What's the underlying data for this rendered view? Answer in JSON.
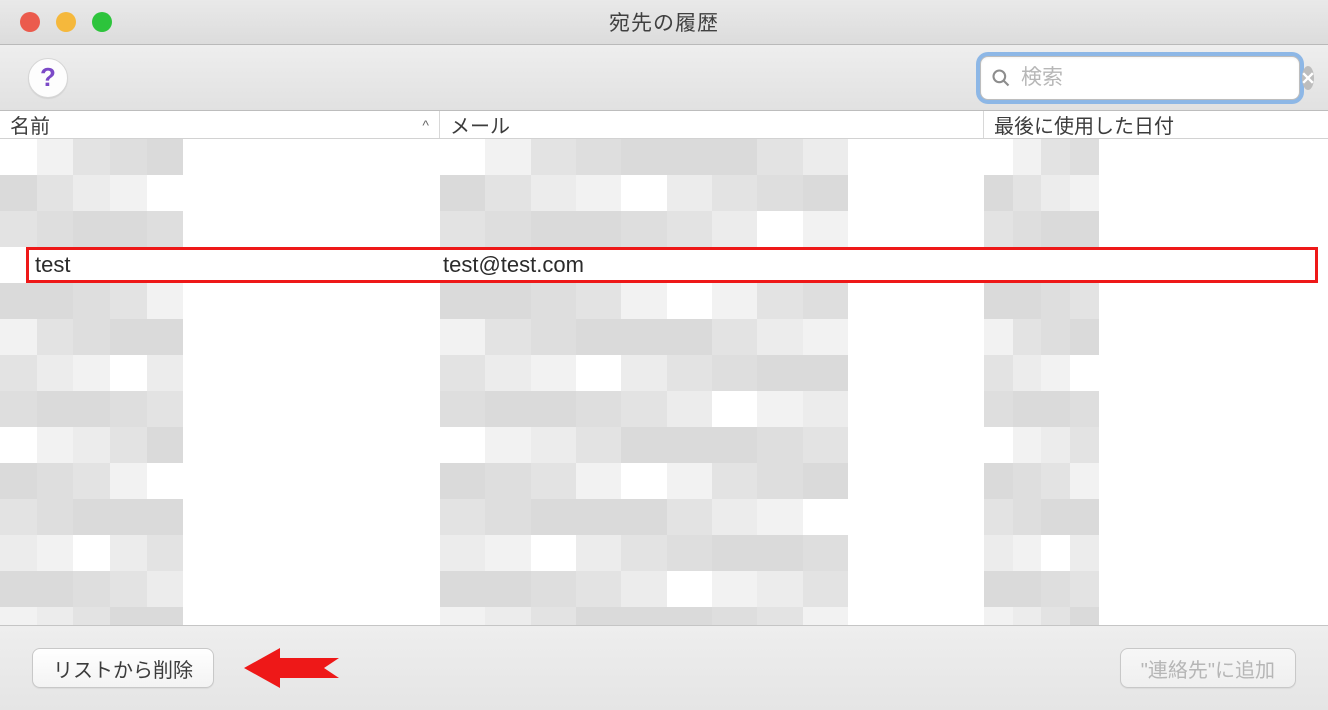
{
  "window": {
    "title": "宛先の履歴"
  },
  "toolbar": {
    "help_label": "?",
    "search_placeholder": "検索"
  },
  "columns": {
    "name": "名前",
    "email": "メール",
    "date": "最後に使用した日付",
    "sort_indicator": "^"
  },
  "selected_row": {
    "name": "test",
    "email": "test@test.com",
    "date": ""
  },
  "footer": {
    "remove_label": "リストから削除",
    "add_contact_label": "\"連絡先\"に追加"
  }
}
